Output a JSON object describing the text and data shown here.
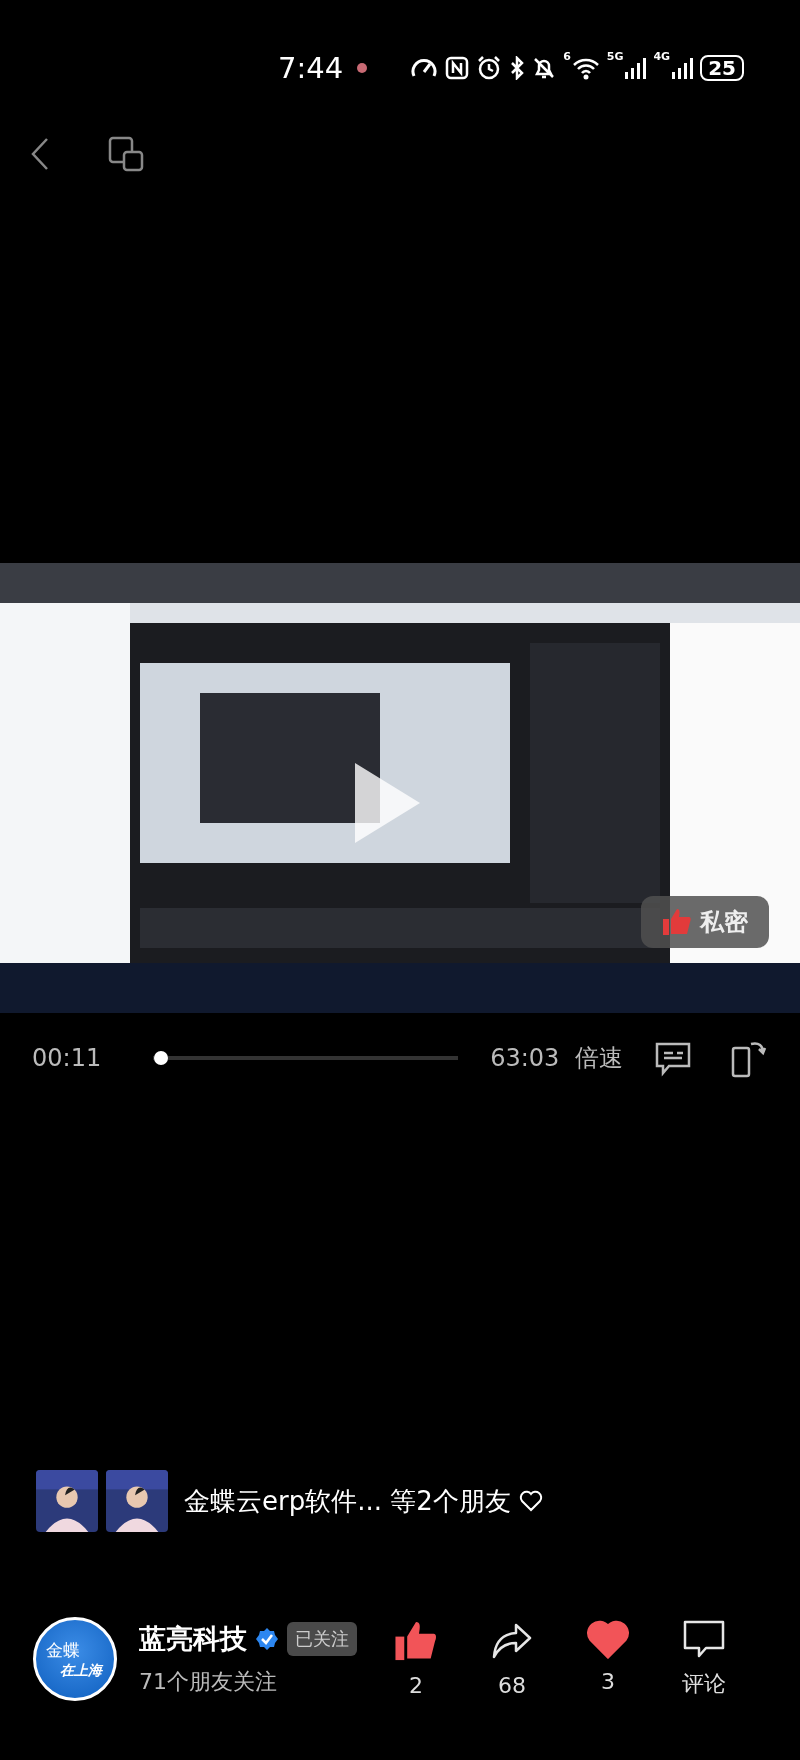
{
  "status_bar": {
    "time": "7:44",
    "wifi_generation": "6",
    "sim_1": "5G",
    "sim_2": "4G",
    "battery": "25"
  },
  "video": {
    "kind": "picture",
    "overlay": {
      "label": "私密"
    }
  },
  "player": {
    "elapsed": "00:11",
    "duration": "63:03",
    "level": 0.003,
    "speed": "倍速"
  },
  "friends": {
    "text": "金蝶云erp软件... 等2个朋友"
  },
  "author": {
    "avatar_line_1": "金蝶",
    "avatar_line_2": "在上海",
    "name": "蓝亮科技",
    "verified": true,
    "follow": "已关注",
    "followers": "71个朋友关注"
  },
  "actions": [
    {
      "kind": "like",
      "count": "2",
      "active": true
    },
    {
      "kind": "share",
      "count": "68",
      "active": false
    },
    {
      "kind": "favorite",
      "count": "3",
      "active": true
    },
    {
      "kind": "comment",
      "count": "评论",
      "active": false
    }
  ]
}
